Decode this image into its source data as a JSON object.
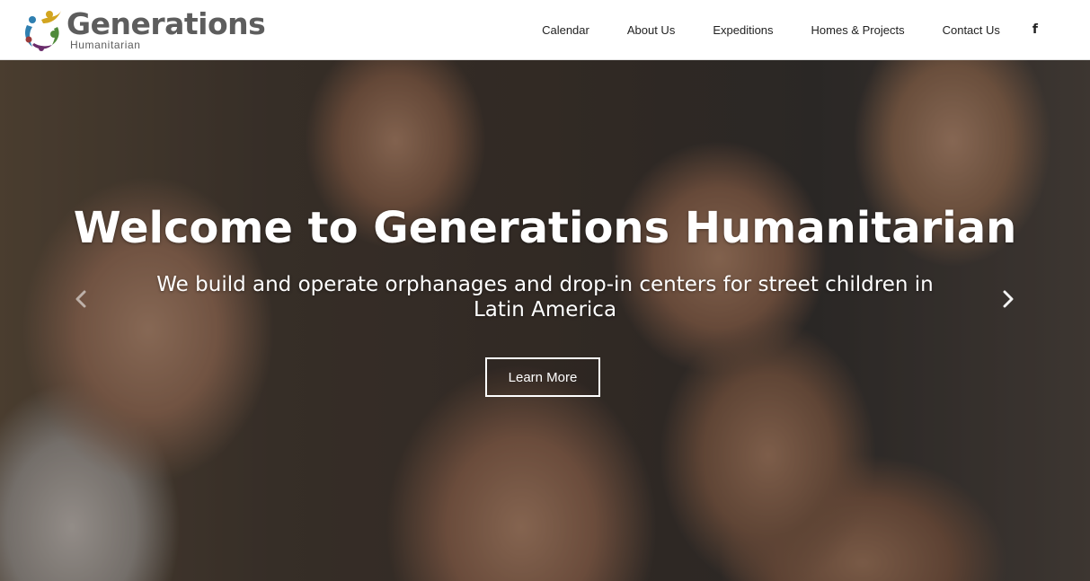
{
  "brand": {
    "name": "Generations",
    "tagline": "Humanitarian",
    "logo_colors": [
      "#6a2c6b",
      "#2f7fb0",
      "#d2a520",
      "#9b3a3a",
      "#4f8a3a"
    ]
  },
  "nav": {
    "items": [
      "Calendar",
      "About Us",
      "Expeditions",
      "Homes & Projects",
      "Contact Us"
    ],
    "facebook_glyph": "f",
    "facebook_icon": "facebook-icon"
  },
  "hero": {
    "title": "Welcome to Generations Humanitarian",
    "subtitle": "We build and operate orphanages and drop-in centers for street children in Latin America",
    "button_label": "Learn More",
    "prev_icon": "chevron-left-icon",
    "next_icon": "chevron-right-icon"
  }
}
